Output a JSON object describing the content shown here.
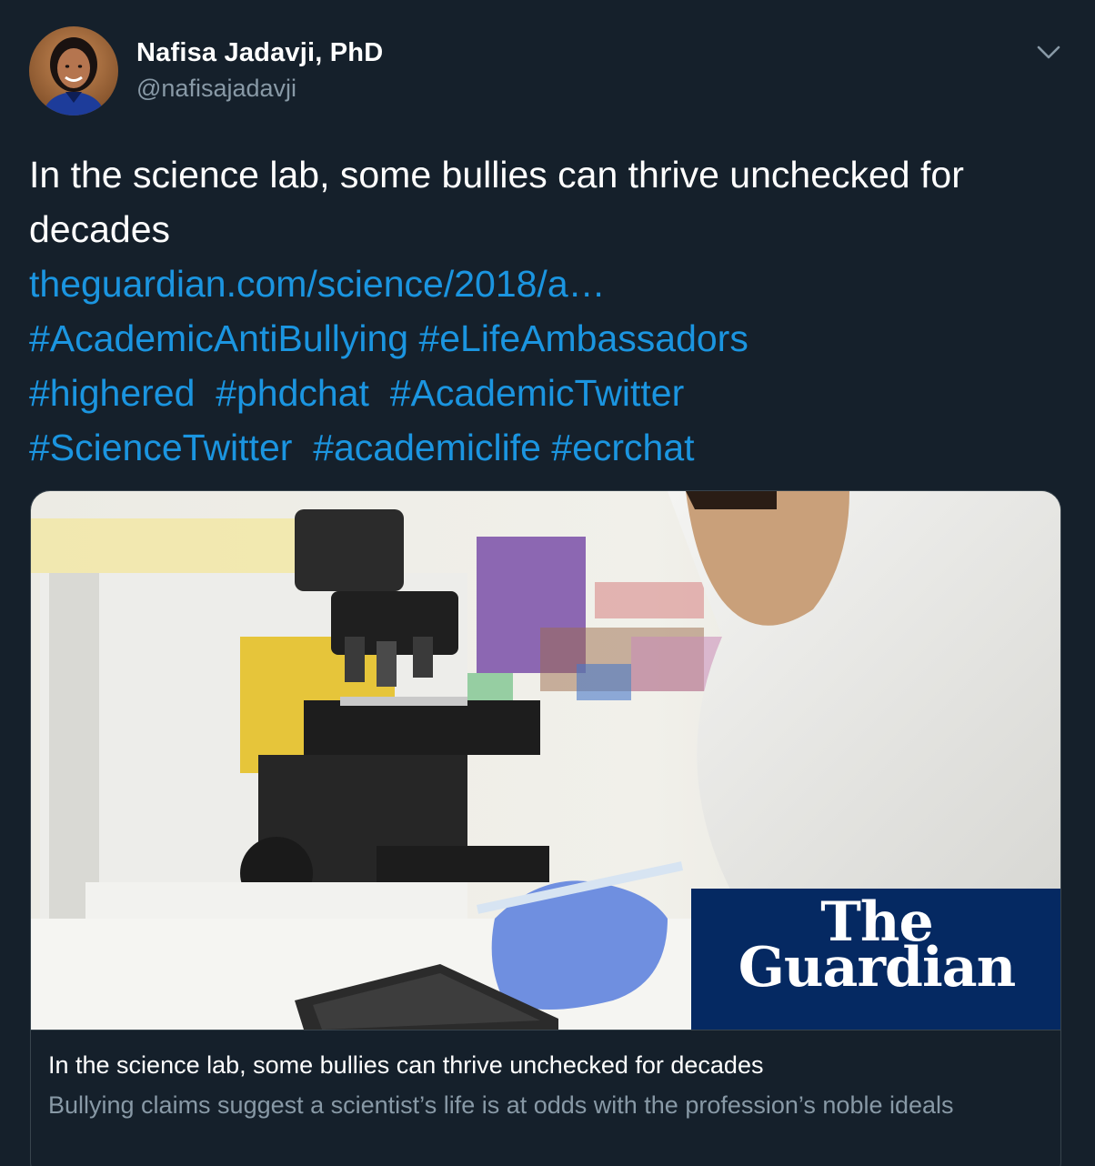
{
  "author": {
    "name": "Nafisa Jadavji, PhD",
    "handle": "@nafisajadavji"
  },
  "tweet": {
    "text": "In the science lab, some bullies can thrive unchecked for decades",
    "text_line1": "In the science lab, some bullies can thrive unchecked for",
    "text_line2": "decades",
    "link": "theguardian.com/science/2018/a…",
    "hashtags": [
      "#AcademicAntiBullying",
      "#eLifeAmbassadors",
      "#highered",
      "#phdchat",
      "#AcademicTwitter",
      "#ScienceTwitter",
      "#academiclife",
      "#ecrchat"
    ]
  },
  "card": {
    "title": "In the science lab, some bullies can thrive unchecked for decades",
    "description": "Bullying claims suggest a scientist’s life is at odds with the profession’s noble ideals",
    "logo_line1": "The",
    "logo_line2": "Guardian"
  },
  "colors": {
    "background": "#15202b",
    "link": "#1b95e0",
    "secondary_text": "#8899a6",
    "border": "#38444d",
    "guardian_blue": "#052962"
  },
  "icons": {
    "caret": "chevron-down-icon"
  }
}
